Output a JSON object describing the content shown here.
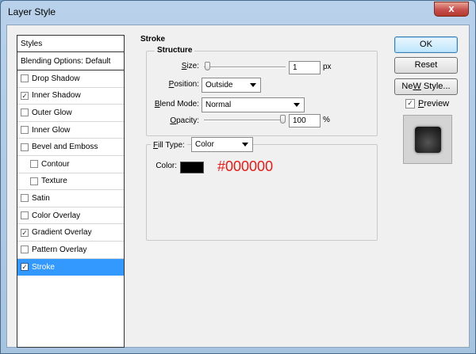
{
  "window": {
    "title": "Layer Style",
    "close_glyph": "x"
  },
  "styles_panel": {
    "header": "Styles",
    "blending": "Blending Options: Default",
    "items": [
      {
        "label": "Drop Shadow",
        "checked": false,
        "indent": false,
        "selected": false
      },
      {
        "label": "Inner Shadow",
        "checked": true,
        "indent": false,
        "selected": false
      },
      {
        "label": "Outer Glow",
        "checked": false,
        "indent": false,
        "selected": false
      },
      {
        "label": "Inner Glow",
        "checked": false,
        "indent": false,
        "selected": false
      },
      {
        "label": "Bevel and Emboss",
        "checked": false,
        "indent": false,
        "selected": false
      },
      {
        "label": "Contour",
        "checked": false,
        "indent": true,
        "selected": false
      },
      {
        "label": "Texture",
        "checked": false,
        "indent": true,
        "selected": false
      },
      {
        "label": "Satin",
        "checked": false,
        "indent": false,
        "selected": false
      },
      {
        "label": "Color Overlay",
        "checked": false,
        "indent": false,
        "selected": false
      },
      {
        "label": "Gradient Overlay",
        "checked": true,
        "indent": false,
        "selected": false
      },
      {
        "label": "Pattern Overlay",
        "checked": false,
        "indent": false,
        "selected": false
      },
      {
        "label": "Stroke",
        "checked": true,
        "indent": false,
        "selected": true
      }
    ]
  },
  "stroke": {
    "title": "Stroke",
    "structure": {
      "legend": "Structure",
      "size_label_u": "S",
      "size_label_rest": "ize:",
      "size_value": "1",
      "size_unit": "px",
      "size_level": 0.01,
      "position_label_u": "P",
      "position_label_rest": "osition:",
      "position_value": "Outside",
      "blend_label_u": "B",
      "blend_label_rest": "lend Mode:",
      "blend_value": "Normal",
      "opacity_label_u": "O",
      "opacity_label_rest": "pacity:",
      "opacity_value": "100",
      "opacity_unit": "%",
      "opacity_level": 1.0
    },
    "fill": {
      "fill_type_label_u": "F",
      "fill_type_label_rest": "ill Type:",
      "fill_type_value": "Color",
      "color_label": "Color:",
      "color_hex": "#000000",
      "swatch_color": "#000000"
    }
  },
  "buttons": {
    "ok": "OK",
    "reset": "Reset",
    "new_style_u": "W",
    "new_style_pre": "Ne",
    "new_style_post": " Style...",
    "preview_u": "P",
    "preview_rest": "review",
    "preview_checked": true
  },
  "colors": {
    "selection": "#3399ff",
    "hex_annotation": "#e41b17"
  }
}
